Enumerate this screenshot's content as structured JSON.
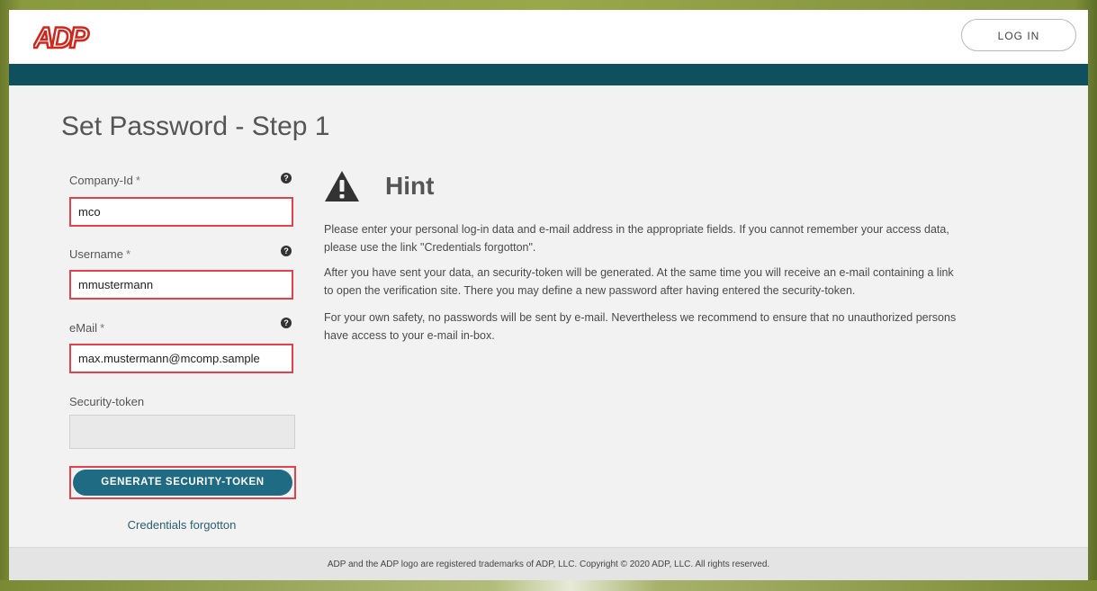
{
  "header": {
    "logo_text": "ADP",
    "login_label": "LOG IN"
  },
  "page": {
    "title": "Set Password - Step 1"
  },
  "form": {
    "company_id": {
      "label": "Company-Id",
      "required": "*",
      "value": "mco"
    },
    "username": {
      "label": "Username",
      "required": "*",
      "value": "mmustermann"
    },
    "email": {
      "label": "eMail",
      "required": "*",
      "value": "max.mustermann@mcomp.sample"
    },
    "security_token": {
      "label": "Security-token",
      "value": ""
    },
    "help_glyph": "?",
    "generate_label": "GENERATE SECURITY-TOKEN",
    "forgot_link": "Credentials forgotton"
  },
  "hint": {
    "title": "Hint",
    "paragraph1_line1": "Please enter your personal log-in data and e-mail address in the appropriate fields. If you cannot remember your access data,",
    "paragraph1_line2": "please use the link \"Credentials forgotton\".",
    "paragraph2_line1": "After you have sent your data, an security-token will be generated. At the same time you will receive an e-mail containing a link",
    "paragraph2_line2": "to open the verification site. There you may define a new password after having entered the security-token.",
    "paragraph3_line1": "For your own safety, no passwords will be sent by e-mail. Nevertheless we recommend to ensure that no unauthorized persons",
    "paragraph3_line2": "have access to your e-mail in-box."
  },
  "footer": {
    "text": "ADP and the ADP logo are registered trademarks of ADP, LLC. Copyright © 2020 ADP, LLC. All rights reserved."
  },
  "colors": {
    "brand_red": "#d0271d",
    "header_bar": "#0f505f",
    "button": "#1f6b84",
    "highlight": "#e3414b"
  }
}
